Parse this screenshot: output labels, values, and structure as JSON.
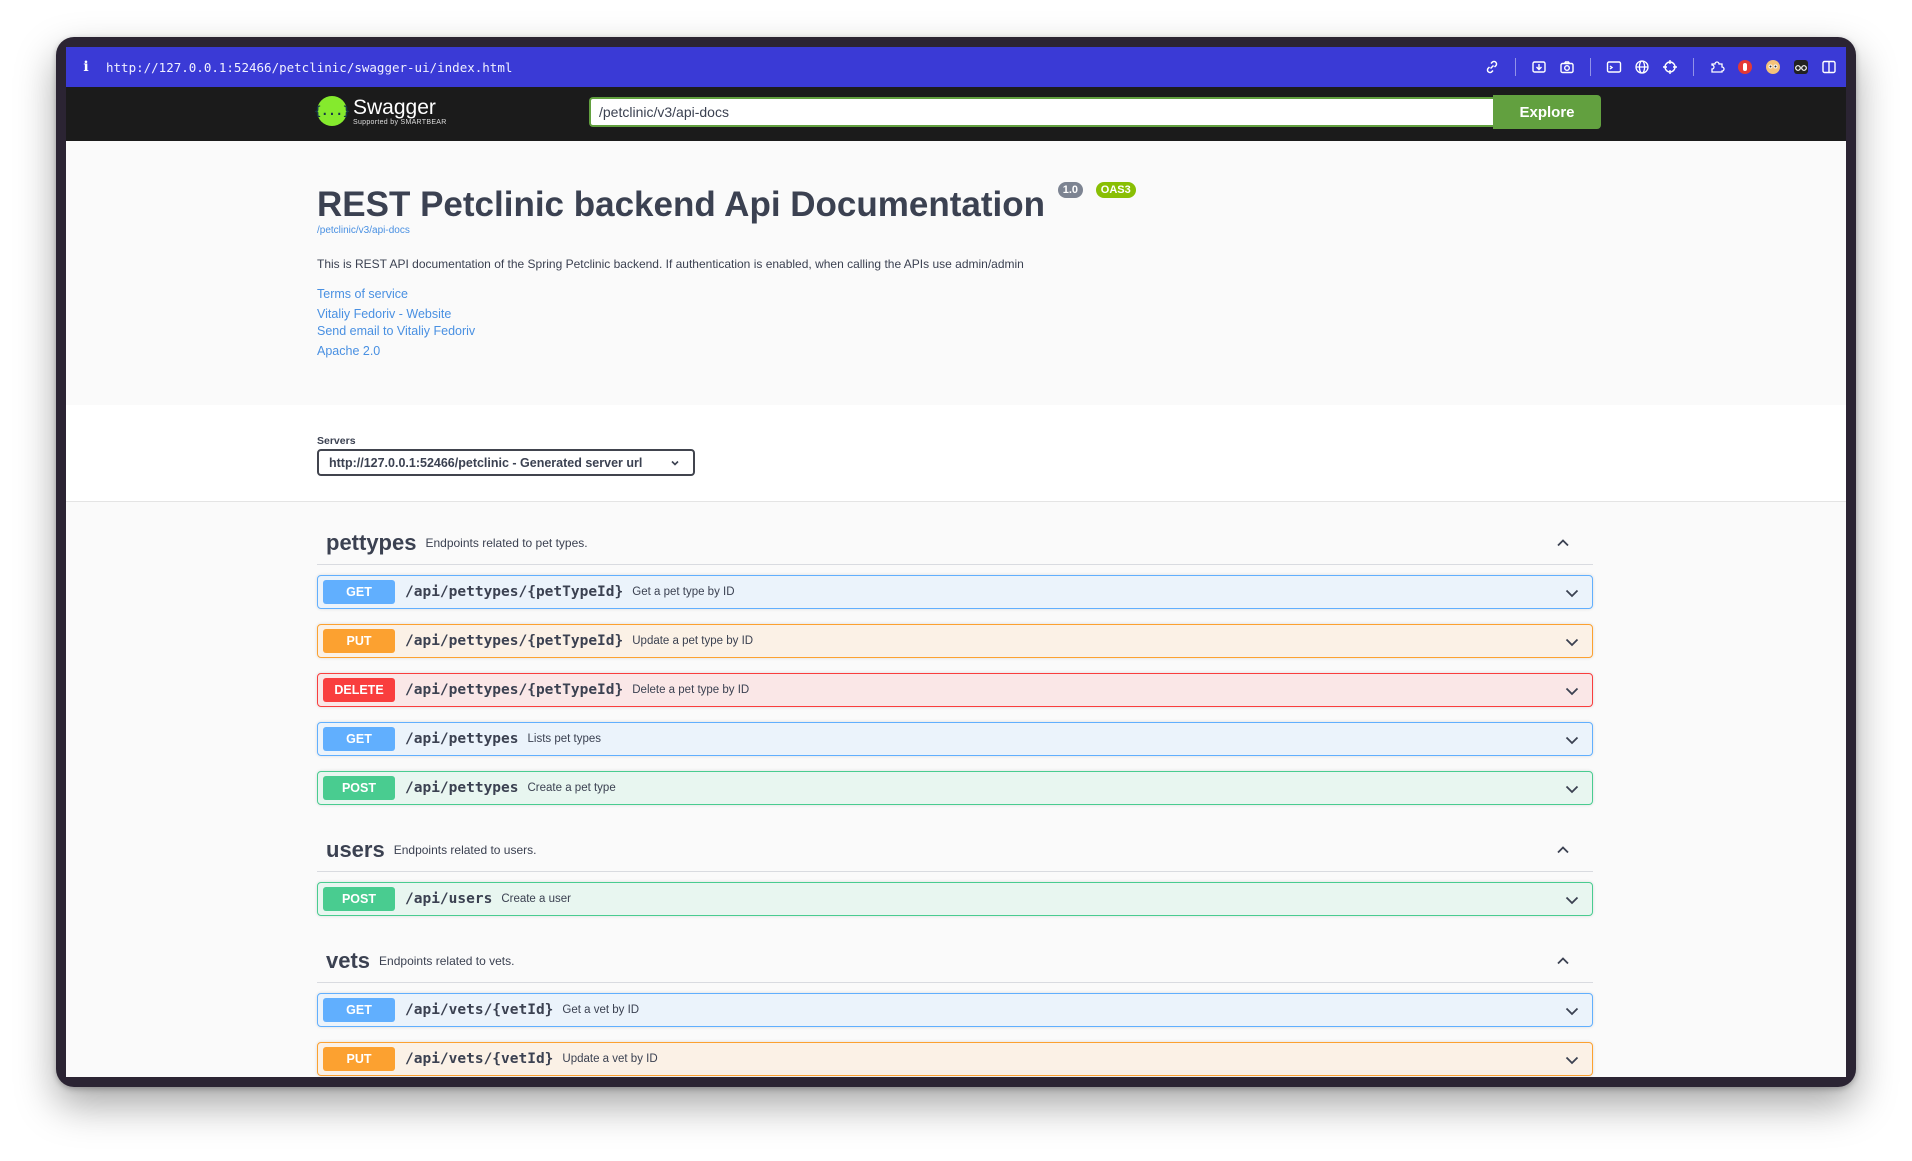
{
  "browser": {
    "info_glyph": "i",
    "url": "http://127.0.0.1:52466/petclinic/swagger-ui/index.html",
    "tool_icons": [
      "link-icon",
      "download-box-icon",
      "camera-icon",
      "terminal-icon",
      "globe-icon",
      "crosshair-icon",
      "extension-icon",
      "hand-icon",
      "owl-icon",
      "glasses-icon",
      "sidebar-icon"
    ]
  },
  "topbar": {
    "logo_name": "Swagger",
    "logo_sub": "Supported by SMARTBEAR",
    "logo_glyph": "{...}",
    "url_value": "/petclinic/v3/api-docs",
    "explore_label": "Explore"
  },
  "info": {
    "title": "REST Petclinic backend Api Documentation",
    "version_badge": "1.0",
    "oas_badge": "OAS3",
    "spec_link": "/petclinic/v3/api-docs",
    "description": "This is REST API documentation of the Spring Petclinic backend. If authentication is enabled, when calling the APIs use admin/admin",
    "terms": "Terms of service",
    "website": "Vitaliy Fedoriv - Website",
    "email": "Send email to Vitaliy Fedoriv",
    "license": "Apache 2.0"
  },
  "servers": {
    "label": "Servers",
    "selected": "http://127.0.0.1:52466/petclinic - Generated server url"
  },
  "tags": [
    {
      "name": "pettypes",
      "description": "Endpoints related to pet types.",
      "ops": [
        {
          "method": "GET",
          "path": "/api/pettypes/{petTypeId}",
          "summary": "Get a pet type by ID"
        },
        {
          "method": "PUT",
          "path": "/api/pettypes/{petTypeId}",
          "summary": "Update a pet type by ID"
        },
        {
          "method": "DELETE",
          "path": "/api/pettypes/{petTypeId}",
          "summary": "Delete a pet type by ID"
        },
        {
          "method": "GET",
          "path": "/api/pettypes",
          "summary": "Lists pet types"
        },
        {
          "method": "POST",
          "path": "/api/pettypes",
          "summary": "Create a pet type"
        }
      ]
    },
    {
      "name": "users",
      "description": "Endpoints related to users.",
      "ops": [
        {
          "method": "POST",
          "path": "/api/users",
          "summary": "Create a user"
        }
      ]
    },
    {
      "name": "vets",
      "description": "Endpoints related to vets.",
      "ops": [
        {
          "method": "GET",
          "path": "/api/vets/{vetId}",
          "summary": "Get a vet by ID"
        },
        {
          "method": "PUT",
          "path": "/api/vets/{vetId}",
          "summary": "Update a vet by ID"
        }
      ]
    }
  ],
  "colors": {
    "browser_bar": "#3a3ad6",
    "topbar": "#1b1b1b",
    "explore": "#62a03f",
    "get": "#61affe",
    "put": "#fca130",
    "delete": "#f93e3e",
    "post": "#49cc90"
  }
}
